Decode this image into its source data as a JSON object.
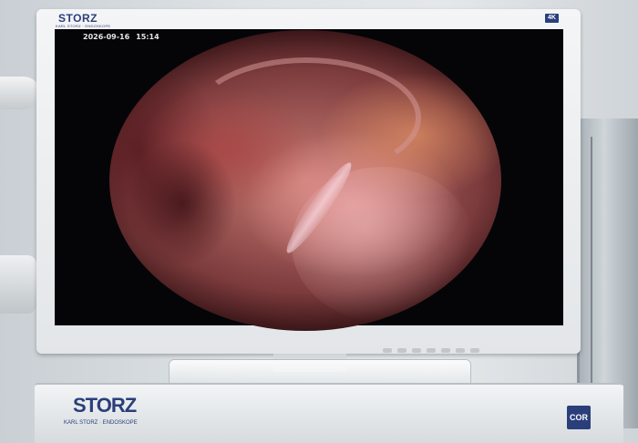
{
  "monitor": {
    "brand": "STORZ",
    "brand_sub": "KARL STORZ · ENDOSKOPE",
    "resolution_badge": "4K"
  },
  "osd": {
    "date": "2026-09-16",
    "time": "15:14"
  },
  "cart": {
    "brand": "STORZ",
    "brand_sub": "KARL STORZ · ENDOSKOPE",
    "badge": "COR"
  },
  "colors": {
    "brand_blue": "#2a3f7a",
    "tissue_pink": "#c97d74",
    "screen_black": "#050508"
  }
}
